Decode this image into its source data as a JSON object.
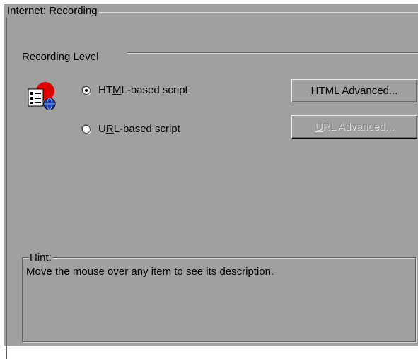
{
  "group": {
    "title": "Internet: Recording"
  },
  "recording": {
    "section_label": "Recording Level",
    "icon": "recording-level-icon",
    "options": [
      {
        "pre": "HT",
        "accel": "M",
        "post": "L-based script",
        "checked": true
      },
      {
        "pre": "U",
        "accel": "R",
        "post": "L-based script",
        "checked": false
      }
    ],
    "buttons": {
      "html_advanced": {
        "accel": "H",
        "rest": "TML Advanced...",
        "enabled": true
      },
      "url_advanced": {
        "accel": "U",
        "rest": "RL Advanced...",
        "enabled": false
      }
    }
  },
  "hint": {
    "title": "Hint:",
    "text": "Move the mouse over any item to see its description."
  },
  "colors": {
    "dialog_background": "#a0a0a0",
    "disabled_text": "#8c8c8c",
    "icon_red": "#e00000",
    "icon_blue": "#1a3fb0"
  }
}
